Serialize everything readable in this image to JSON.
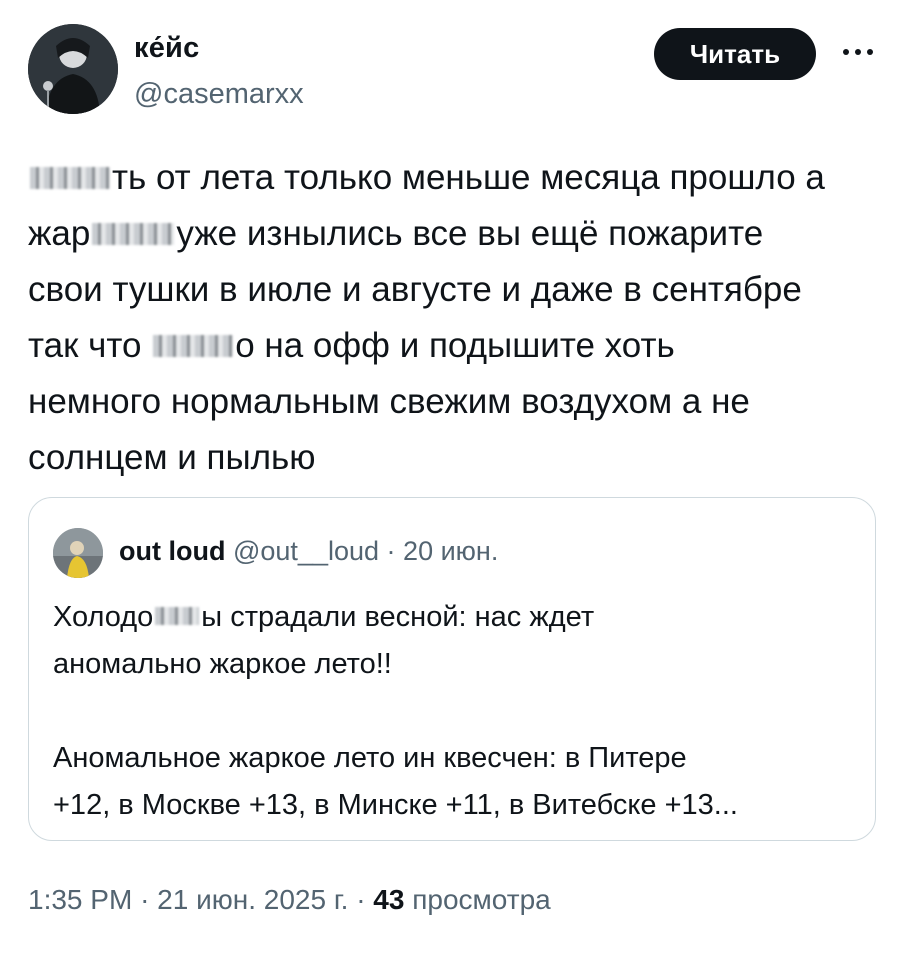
{
  "author": {
    "display_name": "ке́йс",
    "handle": "@casemarxx",
    "follow_label": "Читать",
    "more_icon": "ellipsis-icon"
  },
  "tweet": {
    "line1_pre": "",
    "line1_post": "ть от лета только меньше месяца прошло а",
    "line2_pre": "жар",
    "line2_post": "уже изнылись все вы ещё пожарите",
    "line3": "свои тушки в июле и августе и даже в сентябре",
    "line4_pre": "так что ",
    "line4_post": "о на офф и подышите хоть",
    "line5": "немного нормальным свежим воздухом а не",
    "line6": "солнцем и пылью"
  },
  "quote": {
    "name": "out loud",
    "handle": "@out__loud",
    "dot": "·",
    "date": "20 июн.",
    "line1_pre": "Холодо",
    "line1_post": "ы страдали весной: нас ждет",
    "line2": "аномально жаркое лето!!",
    "line3": "Аномальное жаркое лето ин квесчен: в Питере",
    "line4": "+12, в Москве +13, в Минске +11, в Витебске +13..."
  },
  "footer": {
    "time": "1:35 PM",
    "dot1": "·",
    "date": "21 июн. 2025 г.",
    "dot2": "·",
    "views_count": "43",
    "views_label": "просмотра"
  },
  "colors": {
    "text": "#0f1419",
    "secondary": "#536471",
    "border": "#cfd9de",
    "button_bg": "#0f1419"
  }
}
